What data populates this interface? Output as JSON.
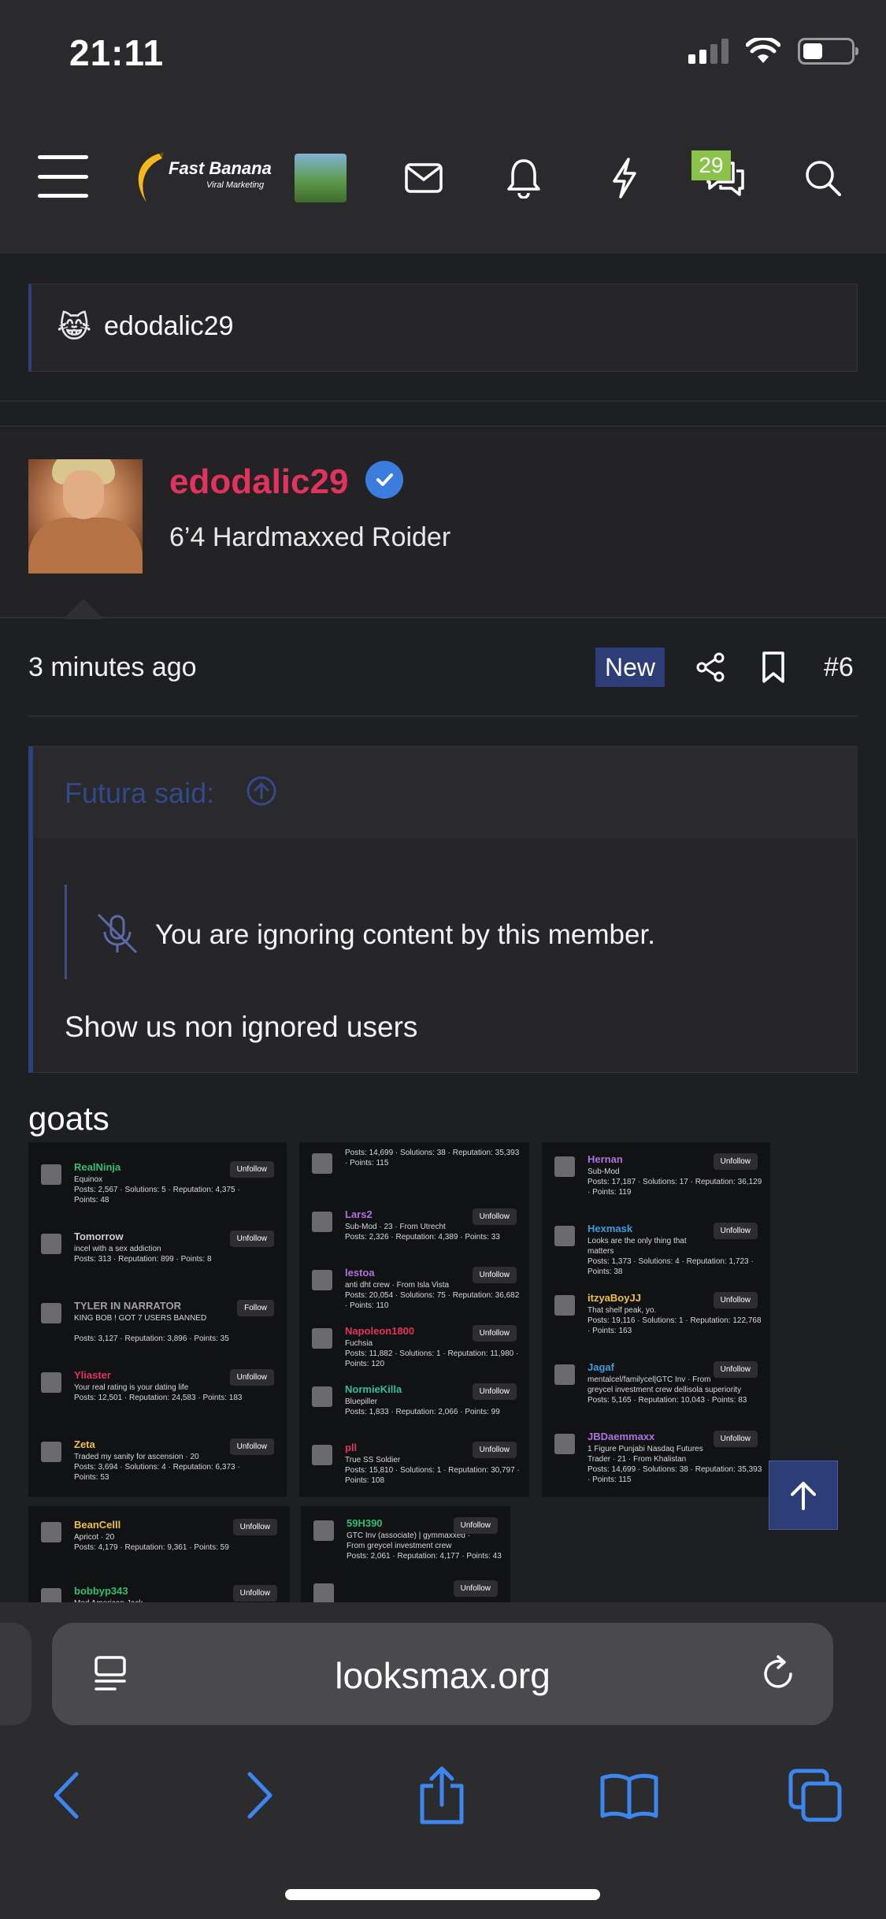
{
  "status_bar": {
    "time": "21:11"
  },
  "header": {
    "logo_text": "Fast Banana",
    "logo_subtext": "Viral Marketing",
    "conversations_badge": "29"
  },
  "breadcrumb": {
    "emoji": "😹",
    "text": "edodalic29"
  },
  "post": {
    "username": "edodalic29",
    "user_title": "6’4 Hardmaxxed Roider",
    "time": "3 minutes ago",
    "new_label": "New",
    "post_number": "#6",
    "quote": {
      "author": "Futura said:",
      "ignored_text": "You are ignoring content by this member.",
      "body": "Show us non ignored users"
    },
    "text": "goats"
  },
  "embedded_list": {
    "col1": [
      {
        "name": "RealNinja",
        "color": "#2fbf71",
        "button": "Unfollow",
        "lines": [
          "Equinox",
          "Posts: 2,567 · Solutions: 5 · Reputation: 4,375 ·",
          "Points: 48"
        ]
      },
      {
        "name": "Tomorrow",
        "color": "#cfcfcf",
        "button": "Unfollow",
        "lines": [
          "incel with a sex addiction",
          "Posts: 313 · Reputation: 899 · Points: 8"
        ]
      },
      {
        "name": "TYLER IN NARRATOR",
        "color": "#a0a0a0",
        "button": "Follow",
        "lines": [
          "KING BOB ! GOT 7 USERS BANNED",
          "",
          "Posts: 3,127 · Reputation: 3,896 · Points: 35"
        ]
      },
      {
        "name": "Yliaster",
        "color": "#e2335f",
        "button": "Unfollow",
        "lines": [
          "Your real rating is your dating life",
          "Posts: 12,501 · Reputation: 24,583 · Points: 183"
        ]
      },
      {
        "name": "Zeta",
        "color": "#f0c040",
        "button": "Unfollow",
        "lines": [
          "Traded my sanity for ascension · 20",
          "Posts: 3,694 · Solutions: 4 · Reputation: 6,373 ·",
          "Points: 53"
        ]
      }
    ],
    "col2": [
      {
        "name": "",
        "color": "#cfcfcf",
        "button": "",
        "lines": [
          "Posts: 14,699 · Solutions: 38 · Reputation: 35,393",
          "· Points: 115"
        ]
      },
      {
        "name": "Lars2",
        "color": "#b070e0",
        "button": "Unfollow",
        "lines": [
          "Sub-Mod · 23 · From Utrecht",
          "Posts: 2,326 · Reputation: 4,389 · Points: 33"
        ]
      },
      {
        "name": "lestoa",
        "color": "#b070e0",
        "button": "Unfollow",
        "lines": [
          "anti dht crew · From Isla Vista",
          "Posts: 20,054 · Solutions: 75 · Reputation: 36,682",
          "· Points: 110"
        ]
      },
      {
        "name": "Napoleon1800",
        "color": "#e2335f",
        "button": "Unfollow",
        "lines": [
          "Fuchsia",
          "Posts: 11,882 · Solutions: 1 · Reputation: 11,980 ·",
          "Points: 120"
        ]
      },
      {
        "name": "NormieKilla",
        "color": "#2fbf9f",
        "button": "Unfollow",
        "lines": [
          "Bluepiller",
          "Posts: 1,833 · Reputation: 2,066 · Points: 99"
        ]
      },
      {
        "name": "pll",
        "color": "#e2335f",
        "button": "Unfollow",
        "lines": [
          "True SS Soldier",
          "Posts: 15,810 · Solutions: 1 · Reputation: 30,797 ·",
          "Points: 108"
        ]
      }
    ],
    "col3": [
      {
        "name": "Hernan",
        "color": "#b070e0",
        "button": "Unfollow",
        "lines": [
          "Sub-Mod",
          "Posts: 17,187 · Solutions: 17 · Reputation: 36,129",
          "· Points: 119"
        ]
      },
      {
        "name": "Hexmask",
        "color": "#3b9ddd",
        "button": "Unfollow",
        "lines": [
          "Looks are the only thing that",
          "matters",
          "Posts: 1,373 · Solutions: 4 · Reputation: 1,723 ·",
          "Points: 38"
        ]
      },
      {
        "name": "itzyaBoyJJ",
        "color": "#f0c040",
        "button": "Unfollow",
        "lines": [
          "That shelf peak, yo.",
          "Posts: 19,116 · Solutions: 1 · Reputation: 122,768",
          "· Points: 163"
        ]
      },
      {
        "name": "Jagaf",
        "color": "#3b9ddd",
        "button": "Unfollow",
        "lines": [
          "mentalcel/familycel|GTC Inv · From",
          "greycel investment crew dellisola superiority",
          "Posts: 5,165 · Reputation: 10,043 · Points: 83"
        ]
      },
      {
        "name": "JBDaemmaxx",
        "color": "#b070e0",
        "button": "Unfollow",
        "lines": [
          "1 Figure Punjabi Nasdaq Futures",
          "Trader · 21 · From Khalistan",
          "Posts: 14,699 · Solutions: 38 · Reputation: 35,393",
          "· Points: 115"
        ]
      }
    ],
    "row2_col1": [
      {
        "name": "BeanCelll",
        "color": "#f0c040",
        "button": "Unfollow",
        "lines": [
          "Apricot · 20",
          "Posts: 4,179 · Reputation: 9,361 · Points: 59"
        ]
      },
      {
        "name": "bobbyp343",
        "color": "#2fbf71",
        "button": "Unfollow",
        "lines": [
          "Mod American Jack"
        ]
      }
    ],
    "row2_col2": [
      {
        "name": "59H390",
        "color": "#2fbf71",
        "button": "Unfollow",
        "lines": [
          "GTC Inv (associate) | gymmaxxed ·",
          "From greycel investment crew",
          "Posts: 2,061 · Reputation: 4,177 · Points: 43"
        ]
      },
      {
        "name": "",
        "color": "#f0c040",
        "button": "Unfollow",
        "lines": []
      }
    ]
  },
  "browser": {
    "url": "looksmax.org"
  },
  "colors": {
    "accent": "#2d3d78",
    "username": "#e2335f",
    "background": "#1e1f22",
    "badge": "#8bc34a"
  }
}
